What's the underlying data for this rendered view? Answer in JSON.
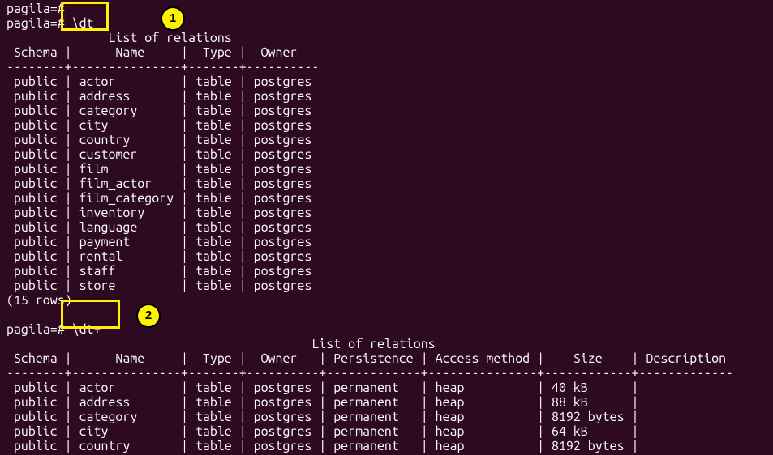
{
  "prompt_prefix": "pagila=# ",
  "cmd1": "\\dt",
  "cmd2": "\\dt+",
  "title1": "List of relations",
  "title2": "List of relations",
  "rowcount1": "(15 rows)",
  "blank": "",
  "annot1": "1",
  "annot2": "2",
  "table1": {
    "headers": {
      "schema": "Schema",
      "name": "Name",
      "type": "Type",
      "owner": "Owner"
    },
    "sep": {
      "c0": "--------",
      "c1": "---------------",
      "c2": "-------",
      "c3": "----------"
    },
    "rows": [
      {
        "schema": "public",
        "name": "actor",
        "type": "table",
        "owner": "postgres"
      },
      {
        "schema": "public",
        "name": "address",
        "type": "table",
        "owner": "postgres"
      },
      {
        "schema": "public",
        "name": "category",
        "type": "table",
        "owner": "postgres"
      },
      {
        "schema": "public",
        "name": "city",
        "type": "table",
        "owner": "postgres"
      },
      {
        "schema": "public",
        "name": "country",
        "type": "table",
        "owner": "postgres"
      },
      {
        "schema": "public",
        "name": "customer",
        "type": "table",
        "owner": "postgres"
      },
      {
        "schema": "public",
        "name": "film",
        "type": "table",
        "owner": "postgres"
      },
      {
        "schema": "public",
        "name": "film_actor",
        "type": "table",
        "owner": "postgres"
      },
      {
        "schema": "public",
        "name": "film_category",
        "type": "table",
        "owner": "postgres"
      },
      {
        "schema": "public",
        "name": "inventory",
        "type": "table",
        "owner": "postgres"
      },
      {
        "schema": "public",
        "name": "language",
        "type": "table",
        "owner": "postgres"
      },
      {
        "schema": "public",
        "name": "payment",
        "type": "table",
        "owner": "postgres"
      },
      {
        "schema": "public",
        "name": "rental",
        "type": "table",
        "owner": "postgres"
      },
      {
        "schema": "public",
        "name": "staff",
        "type": "table",
        "owner": "postgres"
      },
      {
        "schema": "public",
        "name": "store",
        "type": "table",
        "owner": "postgres"
      }
    ]
  },
  "table2": {
    "headers": {
      "schema": "Schema",
      "name": "Name",
      "type": "Type",
      "owner": "Owner",
      "persistence": "Persistence",
      "access": "Access method",
      "size": "Size",
      "desc": "Description"
    },
    "sep": {
      "c0": "--------",
      "c1": "---------------",
      "c2": "-------",
      "c3": "----------",
      "c4": "-------------",
      "c5": "---------------",
      "c6": "------------",
      "c7": "-------------"
    },
    "rows": [
      {
        "schema": "public",
        "name": "actor",
        "type": "table",
        "owner": "postgres",
        "persistence": "permanent",
        "access": "heap",
        "size": "40 kB",
        "desc": ""
      },
      {
        "schema": "public",
        "name": "address",
        "type": "table",
        "owner": "postgres",
        "persistence": "permanent",
        "access": "heap",
        "size": "88 kB",
        "desc": ""
      },
      {
        "schema": "public",
        "name": "category",
        "type": "table",
        "owner": "postgres",
        "persistence": "permanent",
        "access": "heap",
        "size": "8192 bytes",
        "desc": ""
      },
      {
        "schema": "public",
        "name": "city",
        "type": "table",
        "owner": "postgres",
        "persistence": "permanent",
        "access": "heap",
        "size": "64 kB",
        "desc": ""
      },
      {
        "schema": "public",
        "name": "country",
        "type": "table",
        "owner": "postgres",
        "persistence": "permanent",
        "access": "heap",
        "size": "8192 bytes",
        "desc": ""
      }
    ]
  }
}
